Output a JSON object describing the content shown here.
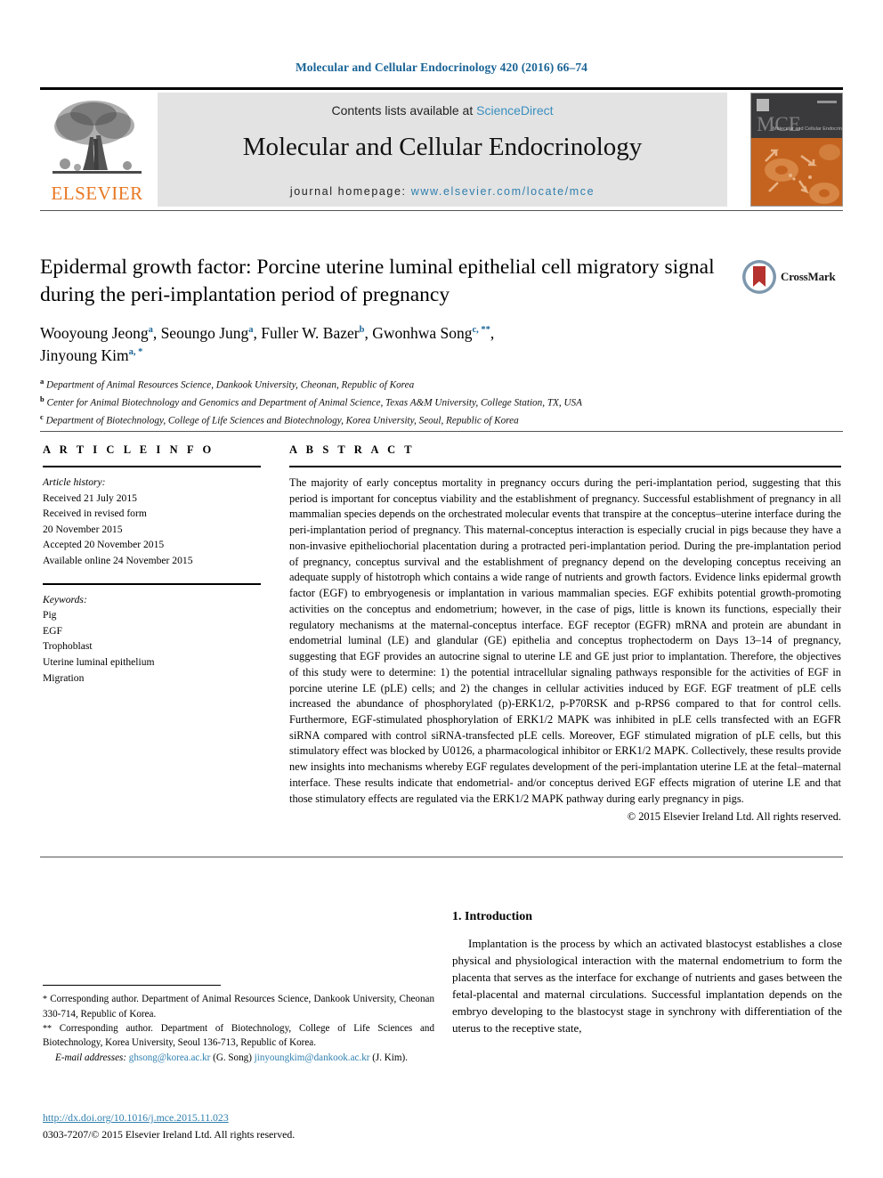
{
  "running_head": "Molecular and Cellular Endocrinology 420 (2016) 66–74",
  "masthead": {
    "contents_prefix": "Contents lists available at ",
    "sciencedirect": "ScienceDirect",
    "journal_name": "Molecular and Cellular Endocrinology",
    "homepage_prefix": "journal homepage: ",
    "homepage_url": "www.elsevier.com/locate/mce",
    "publisher": "ELSEVIER",
    "cover_title": "MCE",
    "cover_subtitle": "Molecular and Cellular Endocrinology"
  },
  "article": {
    "title": "Epidermal growth factor: Porcine uterine luminal epithelial cell migratory signal during the peri-implantation period of pregnancy",
    "crossmark_label": "CrossMark",
    "authors": [
      {
        "name": "Wooyoung Jeong",
        "marks": "a"
      },
      {
        "name": "Seoungo Jung",
        "marks": "a"
      },
      {
        "name": "Fuller W. Bazer",
        "marks": "b"
      },
      {
        "name": "Gwonhwa Song",
        "marks": "c, **"
      },
      {
        "name": "Jinyoung Kim",
        "marks": "a, *"
      }
    ],
    "affiliations": [
      {
        "mark": "a",
        "text": "Department of Animal Resources Science, Dankook University, Cheonan, Republic of Korea"
      },
      {
        "mark": "b",
        "text": "Center for Animal Biotechnology and Genomics and Department of Animal Science, Texas A&M University, College Station, TX, USA"
      },
      {
        "mark": "c",
        "text": "Department of Biotechnology, College of Life Sciences and Biotechnology, Korea University, Seoul, Republic of Korea"
      }
    ]
  },
  "article_info": {
    "heading": "A R T I C L E   I N F O",
    "history_label": "Article history:",
    "history": [
      "Received 21 July 2015",
      "Received in revised form",
      "20 November 2015",
      "Accepted 20 November 2015",
      "Available online 24 November 2015"
    ],
    "keywords_label": "Keywords:",
    "keywords": [
      "Pig",
      "EGF",
      "Trophoblast",
      "Uterine luminal epithelium",
      "Migration"
    ]
  },
  "abstract": {
    "heading": "A B S T R A C T",
    "text": "The majority of early conceptus mortality in pregnancy occurs during the peri-implantation period, suggesting that this period is important for conceptus viability and the establishment of pregnancy. Successful establishment of pregnancy in all mammalian species depends on the orchestrated molecular events that transpire at the conceptus–uterine interface during the peri-implantation period of pregnancy. This maternal-conceptus interaction is especially crucial in pigs because they have a non-invasive epitheliochorial placentation during a protracted peri-implantation period. During the pre-implantation period of pregnancy, conceptus survival and the establishment of pregnancy depend on the developing conceptus receiving an adequate supply of histotroph which contains a wide range of nutrients and growth factors. Evidence links epidermal growth factor (EGF) to embryogenesis or implantation in various mammalian species. EGF exhibits potential growth-promoting activities on the conceptus and endometrium; however, in the case of pigs, little is known its functions, especially their regulatory mechanisms at the maternal-conceptus interface. EGF receptor (EGFR) mRNA and protein are abundant in endometrial luminal (LE) and glandular (GE) epithelia and conceptus trophectoderm on Days 13–14 of pregnancy, suggesting that EGF provides an autocrine signal to uterine LE and GE just prior to implantation. Therefore, the objectives of this study were to determine: 1) the potential intracellular signaling pathways responsible for the activities of EGF in porcine uterine LE (pLE) cells; and 2) the changes in cellular activities induced by EGF. EGF treatment of pLE cells increased the abundance of phosphorylated (p)-ERK1/2, p-P70RSK and p-RPS6 compared to that for control cells. Furthermore, EGF-stimulated phosphorylation of ERK1/2 MAPK was inhibited in pLE cells transfected with an EGFR siRNA compared with control siRNA-transfected pLE cells. Moreover, EGF stimulated migration of pLE cells, but this stimulatory effect was blocked by U0126, a pharmacological inhibitor or ERK1/2 MAPK. Collectively, these results provide new insights into mechanisms whereby EGF regulates development of the peri-implantation uterine LE at the fetal–maternal interface. These results indicate that endometrial- and/or conceptus derived EGF effects migration of uterine LE and that those stimulatory effects are regulated via the ERK1/2 MAPK pathway during early pregnancy in pigs.",
    "copyright": "© 2015 Elsevier Ireland Ltd. All rights reserved."
  },
  "introduction": {
    "heading": "1. Introduction",
    "paragraph": "Implantation is the process by which an activated blastocyst establishes a close physical and physiological interaction with the maternal endometrium to form the placenta that serves as the interface for exchange of nutrients and gases between the fetal-placental and maternal circulations. Successful implantation depends on the embryo developing to the blastocyst stage in synchrony with differentiation of the uterus to the receptive state,"
  },
  "footnotes": {
    "corresponding_1_mark": "*",
    "corresponding_1": "Corresponding author. Department of Animal Resources Science, Dankook University, Cheonan 330-714, Republic of Korea.",
    "corresponding_2_mark": "**",
    "corresponding_2": "Corresponding author. Department of Biotechnology, College of Life Sciences and Biotechnology, Korea University, Seoul 136-713, Republic of Korea.",
    "email_label": "E-mail addresses:",
    "email_1": "ghsong@korea.ac.kr",
    "email_1_owner": "(G. Song)",
    "email_2": "jinyoungkim@dankook.ac.kr",
    "email_2_owner": "(J. Kim)."
  },
  "doi": {
    "url": "http://dx.doi.org/10.1016/j.mce.2015.11.023",
    "issn_line": "0303-7207/© 2015 Elsevier Ireland Ltd. All rights reserved."
  },
  "colors": {
    "link_blue": "#2f7fae",
    "head_blue": "#1a6496",
    "elsevier_orange": "#E87722",
    "band_gray": "#e3e3e3",
    "crossmark_red": "#b5322e"
  }
}
